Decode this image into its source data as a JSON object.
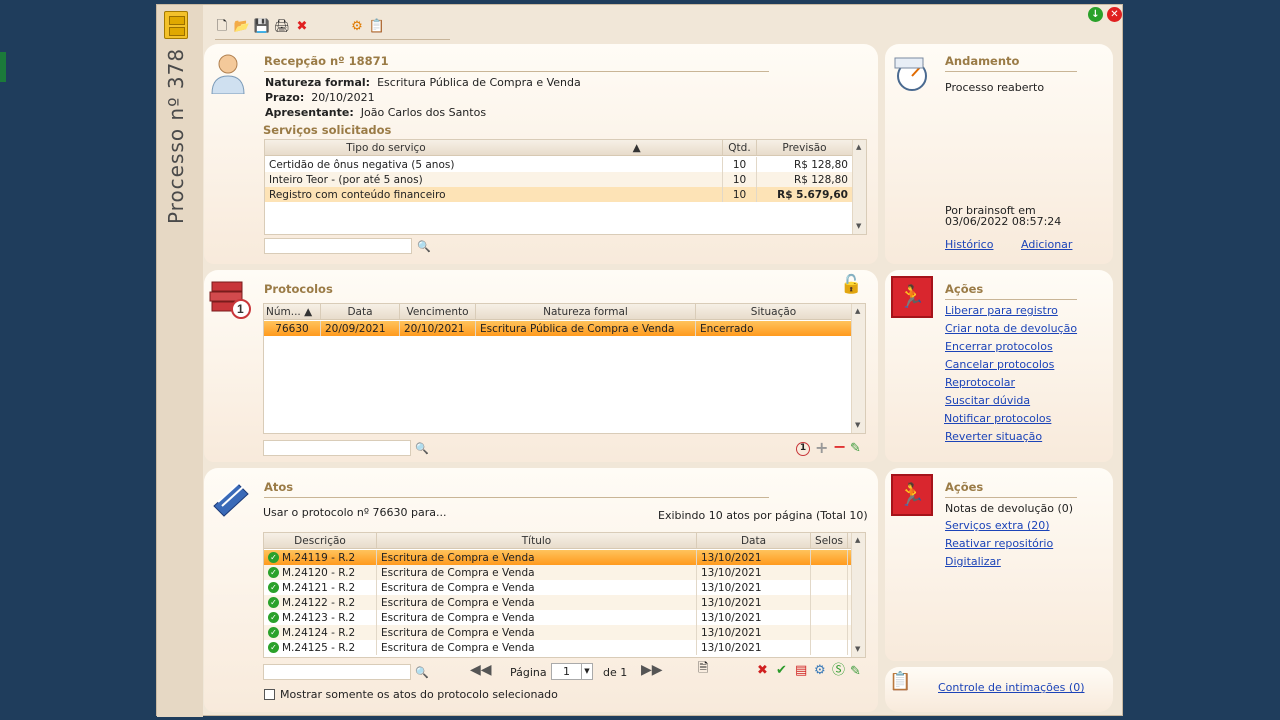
{
  "window": {
    "side_title": "Processo nº 378"
  },
  "toolbar": {
    "new": "🗋",
    "open": "📂",
    "save": "💾",
    "print": "🖨",
    "delete": "✖",
    "refresh": "⚙",
    "copy": "📋"
  },
  "recepcao": {
    "title": "Recepção nº 18871",
    "natureza_label": "Natureza formal:",
    "natureza_value": "Escritura Pública de Compra e Venda",
    "prazo_label": "Prazo:",
    "prazo_value": "20/10/2021",
    "apresentante_label": "Apresentante:",
    "apresentante_value": "João Carlos dos Santos",
    "servicos_title": "Serviços solicitados",
    "columns": [
      "Tipo do serviço",
      "Qtd.",
      "Previsão"
    ],
    "rows": [
      {
        "tipo": "Certidão de ônus negativa (5 anos)",
        "qtd": "10",
        "previsao": "R$ 128,80"
      },
      {
        "tipo": "Inteiro Teor - (por até 5 anos)",
        "qtd": "10",
        "previsao": "R$ 128,80"
      },
      {
        "tipo": "Registro com conteúdo financeiro",
        "qtd": "10",
        "previsao": "R$ 5.679,60"
      }
    ]
  },
  "andamento": {
    "title": "Andamento",
    "status": "Processo reaberto",
    "by": "Por brainsoft em",
    "date": "03/06/2022 08:57:24",
    "historico": "Histórico",
    "adicionar": "Adicionar"
  },
  "protocolos": {
    "title": "Protocolos",
    "badge": "1",
    "columns": [
      "Núm...",
      "Data",
      "Vencimento",
      "Natureza formal",
      "Situação"
    ],
    "rows": [
      {
        "num": "76630",
        "data": "20/09/2021",
        "venc": "20/10/2021",
        "natureza": "Escritura Pública de Compra e Venda",
        "situacao": "Encerrado"
      }
    ]
  },
  "acoes1": {
    "title": "Ações",
    "links": [
      "Liberar para registro",
      "Criar nota de devolução",
      "Encerrar protocolos",
      "Cancelar protocolos",
      "Reprotocolar",
      "Suscitar dúvida",
      "Notificar protocolos",
      "Reverter situação"
    ]
  },
  "atos": {
    "title": "Atos",
    "usar": "Usar o protocolo nº 76630 para...",
    "exibindo": "Exibindo 10 atos por página (Total 10)",
    "columns": [
      "Descrição",
      "Título",
      "Data",
      "Selos"
    ],
    "rows": [
      {
        "desc": "M.24119 - R.2",
        "titulo": "Escritura de Compra e Venda",
        "data": "13/10/2021"
      },
      {
        "desc": "M.24120 - R.2",
        "titulo": "Escritura de Compra e Venda",
        "data": "13/10/2021"
      },
      {
        "desc": "M.24121 - R.2",
        "titulo": "Escritura de Compra e Venda",
        "data": "13/10/2021"
      },
      {
        "desc": "M.24122 - R.2",
        "titulo": "Escritura de Compra e Venda",
        "data": "13/10/2021"
      },
      {
        "desc": "M.24123 - R.2",
        "titulo": "Escritura de Compra e Venda",
        "data": "13/10/2021"
      },
      {
        "desc": "M.24124 - R.2",
        "titulo": "Escritura de Compra e Venda",
        "data": "13/10/2021"
      },
      {
        "desc": "M.24125 - R.2",
        "titulo": "Escritura de Compra e Venda",
        "data": "13/10/2021"
      }
    ],
    "pagina_label": "Página",
    "pagina_value": "1",
    "de_label": "de 1",
    "mostrar": "Mostrar somente os atos do protocolo selecionado"
  },
  "acoes2": {
    "title": "Ações",
    "notas": "Notas de devolução (0)",
    "links": [
      "Serviços extra (20)",
      "Reativar repositório",
      "Digitalizar"
    ]
  },
  "intimacoes": {
    "link": "Controle de intimações (0)"
  }
}
